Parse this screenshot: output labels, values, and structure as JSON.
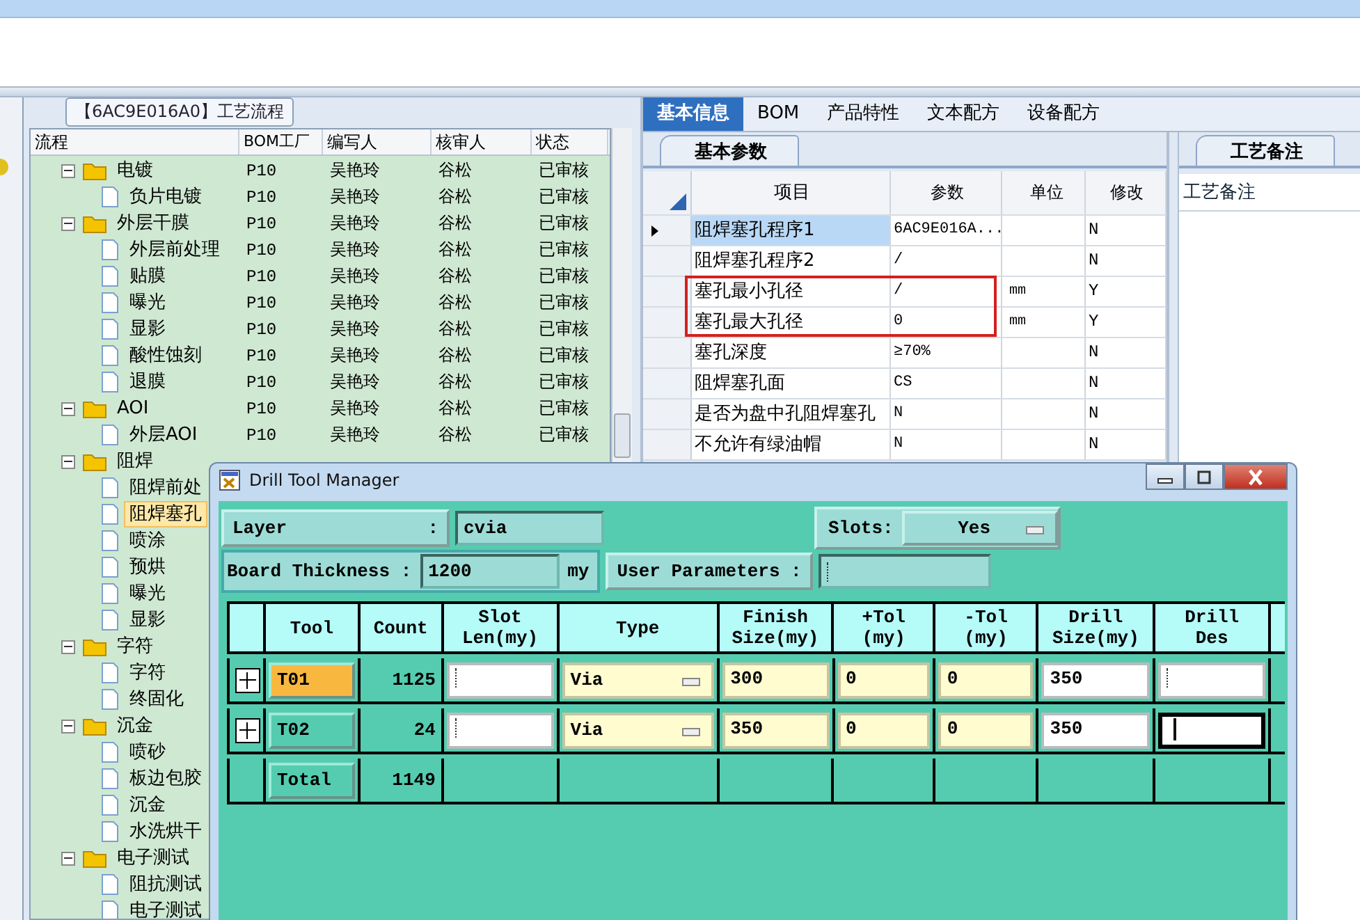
{
  "process_panel": {
    "title": "【6AC9E016A0】工艺流程",
    "columns": [
      "流程",
      "BOM工厂",
      "编写人",
      "核审人",
      "状态"
    ],
    "items": [
      {
        "name": "电镀",
        "bom": "P10",
        "author": "吴艳玲",
        "reviewer": "谷松",
        "status": "已审核",
        "expanded": true,
        "children": [
          {
            "name": "负片电镀",
            "bom": "P10",
            "author": "吴艳玲",
            "reviewer": "谷松",
            "status": "已审核",
            "selected": false
          }
        ]
      },
      {
        "name": "外层干膜",
        "bom": "P10",
        "author": "吴艳玲",
        "reviewer": "谷松",
        "status": "已审核",
        "expanded": true,
        "children": [
          {
            "name": "外层前处理",
            "bom": "P10",
            "author": "吴艳玲",
            "reviewer": "谷松",
            "status": "已审核",
            "selected": false
          },
          {
            "name": "贴膜",
            "bom": "P10",
            "author": "吴艳玲",
            "reviewer": "谷松",
            "status": "已审核",
            "selected": false
          },
          {
            "name": "曝光",
            "bom": "P10",
            "author": "吴艳玲",
            "reviewer": "谷松",
            "status": "已审核",
            "selected": false
          },
          {
            "name": "显影",
            "bom": "P10",
            "author": "吴艳玲",
            "reviewer": "谷松",
            "status": "已审核",
            "selected": false
          },
          {
            "name": "酸性蚀刻",
            "bom": "P10",
            "author": "吴艳玲",
            "reviewer": "谷松",
            "status": "已审核",
            "selected": false
          },
          {
            "name": "退膜",
            "bom": "P10",
            "author": "吴艳玲",
            "reviewer": "谷松",
            "status": "已审核",
            "selected": false
          }
        ]
      },
      {
        "name": "AOI",
        "bom": "P10",
        "author": "吴艳玲",
        "reviewer": "谷松",
        "status": "已审核",
        "expanded": true,
        "children": [
          {
            "name": "外层AOI",
            "bom": "P10",
            "author": "吴艳玲",
            "reviewer": "谷松",
            "status": "已审核",
            "selected": false
          }
        ]
      },
      {
        "name": "阻焊",
        "expanded": true,
        "children": [
          {
            "name": "阻焊前处",
            "selected": false
          },
          {
            "name": "阻焊塞孔",
            "selected": true
          },
          {
            "name": "喷涂",
            "selected": false
          },
          {
            "name": "预烘",
            "selected": false
          },
          {
            "name": "曝光",
            "selected": false
          },
          {
            "name": "显影",
            "selected": false
          }
        ]
      },
      {
        "name": "字符",
        "expanded": true,
        "children": [
          {
            "name": "字符",
            "selected": false
          },
          {
            "name": "终固化",
            "selected": false
          }
        ]
      },
      {
        "name": "沉金",
        "expanded": true,
        "children": [
          {
            "name": "喷砂",
            "selected": false
          },
          {
            "name": "板边包胶",
            "selected": false
          },
          {
            "name": "沉金",
            "selected": false
          },
          {
            "name": "水洗烘干",
            "selected": false
          }
        ]
      },
      {
        "name": "电子测试",
        "expanded": true,
        "children": [
          {
            "name": "阻抗测试",
            "selected": false
          },
          {
            "name": "电子测试",
            "selected": false
          }
        ]
      }
    ]
  },
  "detail_panel": {
    "tabs": [
      {
        "label": "基本信息",
        "selected": true
      },
      {
        "label": "BOM",
        "selected": false
      },
      {
        "label": "产品特性",
        "selected": false
      },
      {
        "label": "文本配方",
        "selected": false
      },
      {
        "label": "设备配方",
        "selected": false
      }
    ],
    "subtab": "基本参数",
    "columns": [
      "项目",
      "参数",
      "单位",
      "修改"
    ],
    "rows": [
      {
        "item": "阻焊塞孔程序1",
        "param": "6AC9E016A...",
        "modified": "N",
        "selected": true,
        "highlighted": false
      },
      {
        "item": "阻焊塞孔程序2",
        "param": "/",
        "modified": "N",
        "selected": false,
        "highlighted": false
      },
      {
        "item": "塞孔最小孔径",
        "param": "/",
        "unit": "mm",
        "modified": "Y",
        "selected": false,
        "highlighted": true
      },
      {
        "item": "塞孔最大孔径",
        "param": "0",
        "unit": "mm",
        "modified": "Y",
        "selected": false,
        "highlighted": true
      },
      {
        "item": "塞孔深度",
        "param": "≥70%",
        "modified": "N",
        "selected": false,
        "highlighted": false
      },
      {
        "item": "阻焊塞孔面",
        "param": "CS",
        "modified": "N",
        "selected": false,
        "highlighted": false
      },
      {
        "item": "是否为盘中孔阻焊塞孔",
        "param": "N",
        "modified": "N",
        "selected": false,
        "highlighted": false
      },
      {
        "item": "不允许有绿油帽",
        "param": "N",
        "modified": "N",
        "selected": false,
        "highlighted": false
      }
    ]
  },
  "notes_panel": {
    "tab": "工艺备注",
    "label": "工艺备注"
  },
  "dialog": {
    "title": "Drill Tool Manager",
    "layer": {
      "label": "Layer",
      "colon": ":",
      "value": "cvia"
    },
    "slots": {
      "label": "Slots:",
      "value": "Yes"
    },
    "board_thickness": {
      "label": "Board Thickness :",
      "value": "1200",
      "unit": "my"
    },
    "user_parameters": {
      "label": "User Parameters :"
    },
    "columns": [
      [
        "Tool"
      ],
      [
        "Count"
      ],
      [
        "Slot",
        "Len(my)"
      ],
      [
        "Type"
      ],
      [
        "Finish",
        "Size(my)"
      ],
      [
        "+Tol",
        "(my)"
      ],
      [
        "-Tol",
        "(my)"
      ],
      [
        "Drill",
        "Size(my)"
      ],
      [
        "Drill",
        "Des"
      ]
    ],
    "tools": [
      {
        "tool": "T01",
        "selected": true,
        "count": "1125",
        "type": "Via",
        "finish": "300",
        "plus_tol": "0",
        "minus_tol": "0",
        "drill": "350",
        "focused": false
      },
      {
        "tool": "T02",
        "selected": false,
        "count": "24",
        "type": "Via",
        "finish": "350",
        "plus_tol": "0",
        "minus_tol": "0",
        "drill": "350",
        "focused": true
      }
    ],
    "total": {
      "label": "Total",
      "count": "1149"
    }
  }
}
